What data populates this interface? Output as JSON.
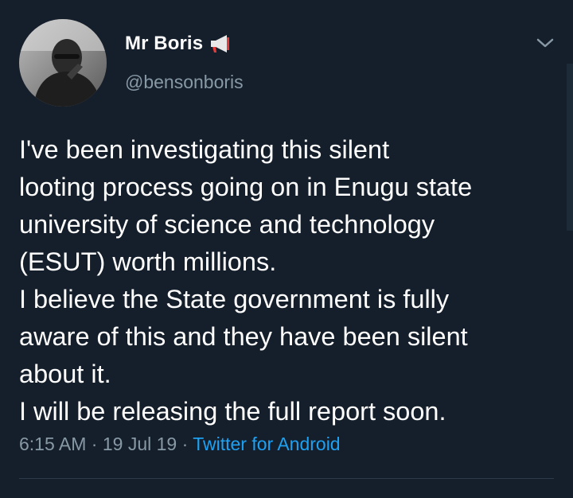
{
  "user": {
    "display_name": "Mr Boris",
    "handle": "@bensonboris",
    "badge_icon": "megaphone-icon"
  },
  "tweet": {
    "lines": [
      "I've been investigating this silent",
      "looting process going on in Enugu state",
      "university of science and technology",
      "(ESUT) worth millions.",
      "I believe the State government is fully",
      "aware of this and they have been silent",
      "about it.",
      "I will be releasing the full report soon."
    ]
  },
  "meta": {
    "time": "6:15 AM",
    "sep1": " · ",
    "date": "19 Jul 19",
    "sep2": " · ",
    "source": "Twitter for Android"
  },
  "icons": {
    "menu": "chevron-down-icon"
  },
  "colors": {
    "background": "#151f2b",
    "secondary_text": "#8899a6",
    "link": "#1da1f2"
  }
}
